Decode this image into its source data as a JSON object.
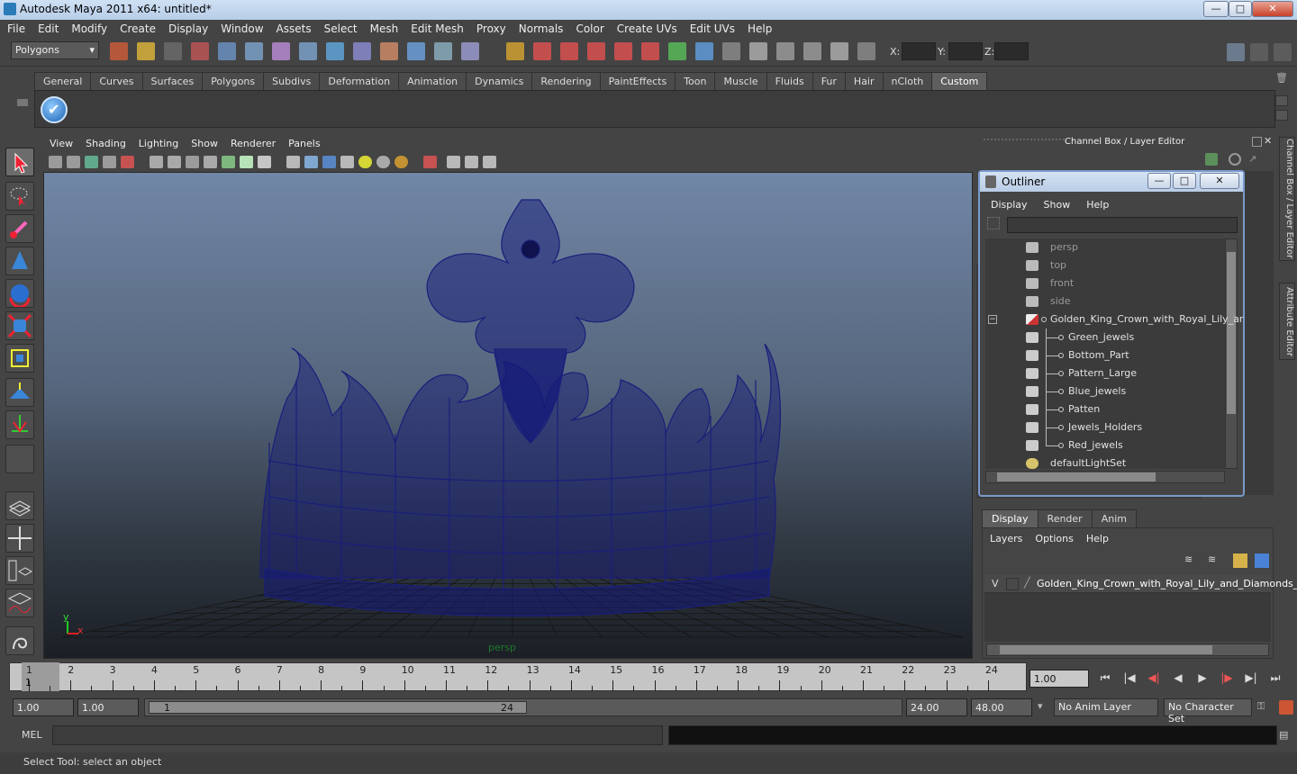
{
  "window": {
    "title": "Autodesk Maya 2011 x64: untitled*",
    "minimize": "—",
    "maximize": "□",
    "close": "✕"
  },
  "menubar": [
    "File",
    "Edit",
    "Modify",
    "Create",
    "Display",
    "Window",
    "Assets",
    "Select",
    "Mesh",
    "Edit Mesh",
    "Proxy",
    "Normals",
    "Color",
    "Create UVs",
    "Edit UVs",
    "Help"
  ],
  "status": {
    "mode": "Polygons",
    "x_label": "X:",
    "y_label": "Y:",
    "z_label": "Z:"
  },
  "shelf": {
    "tabs": [
      "General",
      "Curves",
      "Surfaces",
      "Polygons",
      "Subdivs",
      "Deformation",
      "Animation",
      "Dynamics",
      "Rendering",
      "PaintEffects",
      "Toon",
      "Muscle",
      "Fluids",
      "Fur",
      "Hair",
      "nCloth",
      "Custom"
    ],
    "active": "Custom"
  },
  "viewport": {
    "menus": [
      "View",
      "Shading",
      "Lighting",
      "Show",
      "Renderer",
      "Panels"
    ],
    "camera_label": "persp",
    "axis_x": "x",
    "axis_y": "y"
  },
  "channel_box": {
    "title": "Channel Box / Layer Editor"
  },
  "side_tabs": {
    "channel": "Channel Box / Layer Editor",
    "attribute": "Attribute Editor"
  },
  "outliner": {
    "title": "Outliner",
    "menus": [
      "Display",
      "Show",
      "Help"
    ],
    "items": [
      {
        "label": "persp",
        "dim": true,
        "level": 0,
        "icon": "camera-icon"
      },
      {
        "label": "top",
        "dim": true,
        "level": 0,
        "icon": "camera-icon"
      },
      {
        "label": "front",
        "dim": true,
        "level": 0,
        "icon": "camera-icon"
      },
      {
        "label": "side",
        "dim": true,
        "level": 0,
        "icon": "camera-icon"
      },
      {
        "label": "Golden_King_Crown_with_Royal_Lily_ar",
        "dim": false,
        "level": 0,
        "icon": "group-icon"
      },
      {
        "label": "Green_jewels",
        "dim": false,
        "level": 1,
        "icon": "mesh-icon"
      },
      {
        "label": "Bottom_Part",
        "dim": false,
        "level": 1,
        "icon": "mesh-icon"
      },
      {
        "label": "Pattern_Large",
        "dim": false,
        "level": 1,
        "icon": "mesh-icon"
      },
      {
        "label": "Blue_jewels",
        "dim": false,
        "level": 1,
        "icon": "mesh-icon"
      },
      {
        "label": "Patten",
        "dim": false,
        "level": 1,
        "icon": "mesh-icon"
      },
      {
        "label": "Jewels_Holders",
        "dim": false,
        "level": 1,
        "icon": "mesh-icon"
      },
      {
        "label": "Red_jewels",
        "dim": false,
        "level": 1,
        "icon": "mesh-icon"
      },
      {
        "label": "defaultLightSet",
        "dim": false,
        "level": 0,
        "icon": "light-set-icon"
      }
    ]
  },
  "layer_editor": {
    "tabs": [
      "Display",
      "Render",
      "Anim"
    ],
    "active_tab": "Display",
    "menus": [
      "Layers",
      "Options",
      "Help"
    ],
    "layer_visibility": "V",
    "layer_name": "Golden_King_Crown_with_Royal_Lily_and_Diamonds_"
  },
  "timeline": {
    "ticks": [
      "1",
      "2",
      "3",
      "4",
      "5",
      "6",
      "7",
      "8",
      "9",
      "10",
      "11",
      "12",
      "13",
      "14",
      "15",
      "16",
      "17",
      "18",
      "19",
      "20",
      "21",
      "22",
      "23",
      "24"
    ],
    "current_frame_label": "1",
    "current_time": "1.00"
  },
  "range": {
    "start": "1.00",
    "playback_start": "1.00",
    "slider_start": "1",
    "slider_end": "24",
    "playback_end": "24.00",
    "end": "48.00",
    "anim_layer": "No Anim Layer",
    "character_set": "No Character Set"
  },
  "command": {
    "label": "MEL"
  },
  "help_line": "Select Tool: select an object"
}
